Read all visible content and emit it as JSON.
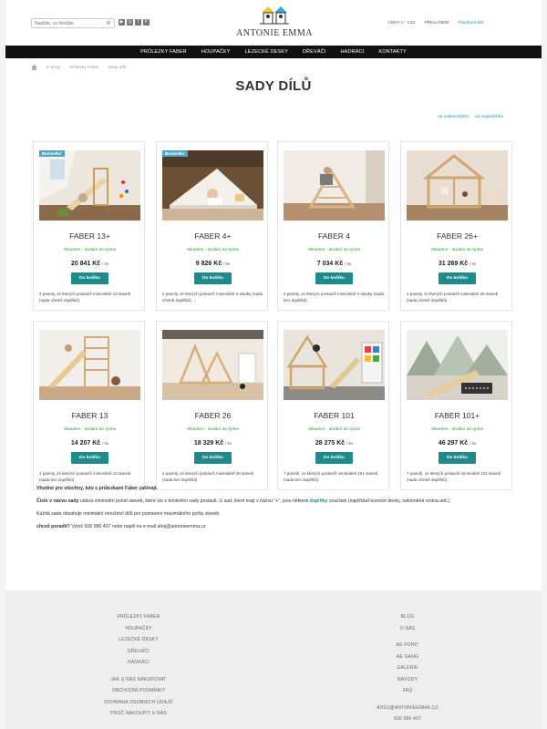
{
  "header": {
    "search_placeholder": "Napište, co hledáte",
    "logo_text": "ANTONIE EMMA",
    "currency_label": "CENY V:",
    "currency": "CZK",
    "login": "PŘIHLÁŠENÍ",
    "cart": "Prázdný košík",
    "social_icons": [
      "youtube-icon",
      "instagram-icon",
      "facebook-icon",
      "pinterest-icon"
    ]
  },
  "nav": {
    "items": [
      "PRŮLEZKY FABER",
      "HOUPAČKY",
      "LEZECKÉ DESKY",
      "DŘEVÁČI",
      "HADRÁCI",
      "KONTAKTY"
    ]
  },
  "breadcrumb": [
    "E-shop",
    "Průlezky Faber",
    "Sady dílů"
  ],
  "page_title": "SADY DÍLŮ",
  "sort": {
    "cheapest": "od nejlevnějšího",
    "most_expensive": "od nejdražšího"
  },
  "common": {
    "stock": "Skladem - dodání do týdne",
    "buy": "Do košíku",
    "unit": "/ ks",
    "bestseller": "Bestseller"
  },
  "products": [
    {
      "name": "FABER 13+",
      "price": "20 841 Kč",
      "desc": "4 panely, ze kterých postavíš minimálně 13 staveb (sada včetně doplňků)",
      "bestseller": true
    },
    {
      "name": "FABER 4+",
      "price": "9 826 Kč",
      "desc": "2 panely, ze kterých postavíš minimálně 4 stavby (sada včetně doplňků)    ...",
      "bestseller": true
    },
    {
      "name": "FABER 4",
      "price": "7 034 Kč",
      "desc": "2 panely, ze kterých postavíš minimálně 4 stavby (sada bez doplňků)",
      "bestseller": false
    },
    {
      "name": "FABER 26+",
      "price": "31 269 Kč",
      "desc": "4 panely, ze kterých postavíš minimálně 26 staveb (sada včetně doplňků)",
      "bestseller": false
    },
    {
      "name": "FABER 13",
      "price": "14 207 Kč",
      "desc": "4 panely, ze kterých postavíš minimálně 13 staveb (sada bez doplňků)",
      "bestseller": false
    },
    {
      "name": "FABER 26",
      "price": "18 329 Kč",
      "desc": "4 panely, ze kterých postavíš minimálně 26 staveb (sada bez doplňků)",
      "bestseller": false
    },
    {
      "name": "FABER 101",
      "price": "28 275 Kč",
      "desc": "7 panelů, ze kterých postavíš minimálně 101 staveb (sada bez doplňků)",
      "bestseller": false
    },
    {
      "name": "FABER 101+",
      "price": "46 297 Kč",
      "desc": "7 panelů, ze kterých postavíš minimálně 101 staveb (sada včetně doplňků)",
      "bestseller": false
    }
  ],
  "info": {
    "p1": "Vhodné pro všechny, kdo s průlezkami Faber začínají.",
    "p2_bold": "Číslo v názvu sady",
    "p2_a": " udává minimální počet staveb, které lze z konkrétní sady postavit. U sad, které mají v názvu \"+\", jsou některé ",
    "p2_accent": "doplňky",
    "p2_b": " součástí (například lezecké desky, nakloněná rovina atd.).",
    "p3": "Každá sada obsahuje minimální množství dílů pro postavení maximálního počtu staveb.",
    "p4_bold": "chceš poradit?",
    "p4": " Vytoč 606 586 407 nebo napiš na e-mail ahoj@antonieemma.cz"
  },
  "footer": {
    "left_group1": [
      "PRŮLEZKY FABER",
      "HOUPAČKY",
      "LEZECKÉ DESKY",
      "DŘEVÁČI",
      "HADRÁCI"
    ],
    "left_group2": [
      "JAK U NÁS NAKUPOVAT",
      "OBCHODNÍ PODMÍNKY",
      "OCHRANA OSOBNÍCH ÚDAJŮ",
      "PROČ NAKOUPIT U NÁS"
    ],
    "right_group1": [
      "BLOG",
      "O NÁS"
    ],
    "right_group2": [
      "AE POINT",
      "AE GANG",
      "GALERIE",
      "NÁVODY",
      "FAQ"
    ],
    "right_group3": [
      "AHOJ@ANTONIEEMMA.CZ",
      "606 586 407"
    ]
  },
  "colors": {
    "accent": "#1f8a8a",
    "stock_green": "#2a9d3f",
    "nav_bg": "#111111",
    "link": "#2b8fb0"
  }
}
